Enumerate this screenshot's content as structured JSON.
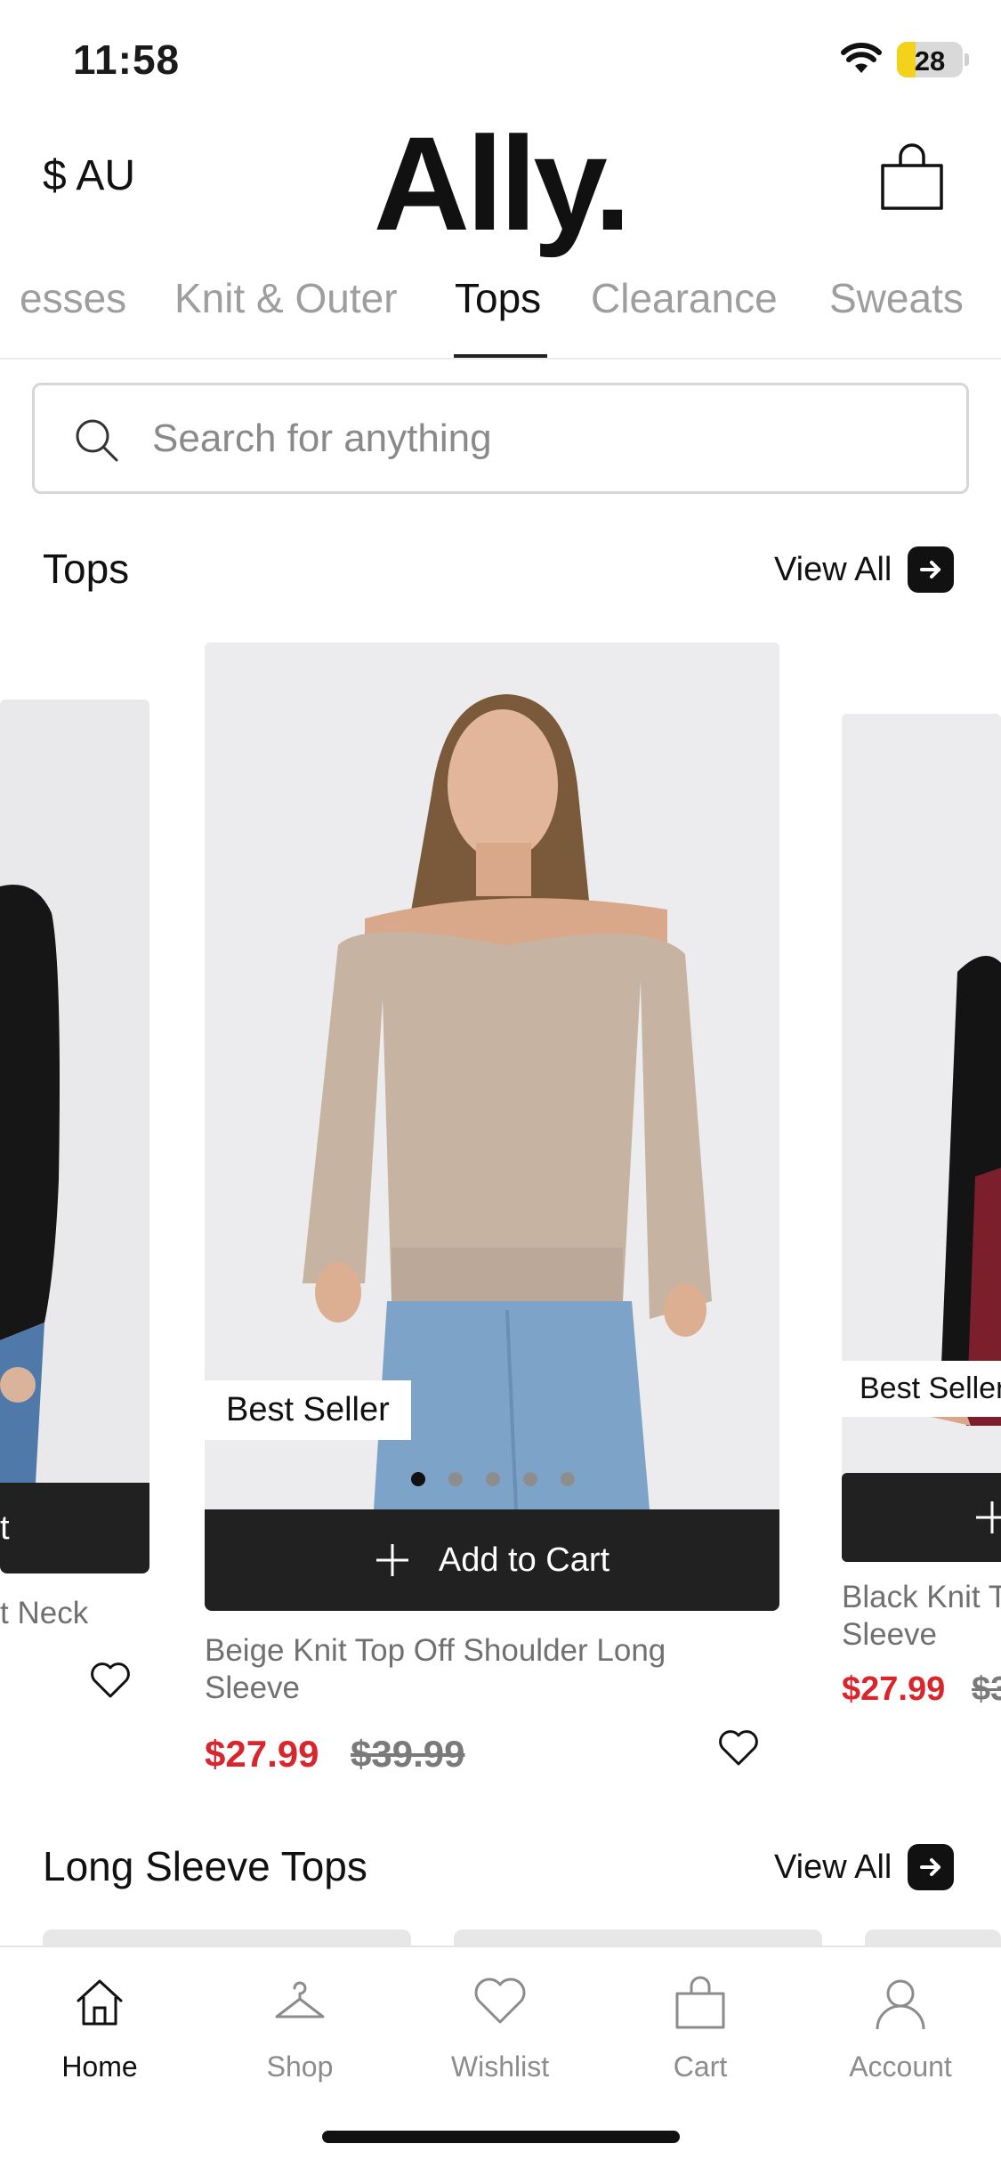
{
  "status_bar": {
    "time": "11:58",
    "battery": "28",
    "battery_fraction": 0.28
  },
  "header": {
    "currency": "$ AU",
    "logo": "Ally.",
    "bag_icon": "shopping-bag-icon"
  },
  "categories": {
    "items": [
      {
        "label": "esses"
      },
      {
        "label": "Knit & Outer"
      },
      {
        "label": "Tops"
      },
      {
        "label": "Clearance"
      },
      {
        "label": "Sweats"
      }
    ],
    "active": "Tops"
  },
  "search": {
    "placeholder": "Search for anything",
    "value": ""
  },
  "section_tops": {
    "title": "Tops",
    "view_all": "View All"
  },
  "products": [
    {
      "name": "t Neck",
      "cart_label": "t",
      "image_desc": "black long sleeve top"
    },
    {
      "badge": "Best Seller",
      "cart_label": "Add to Cart",
      "name": "Beige Knit Top Off Shoulder Long Sleeve",
      "price_sale": "$27.99",
      "price_original": "$39.99",
      "image_dots": 5,
      "active_dot": 0,
      "image_desc": "beige knit off shoulder top"
    },
    {
      "badge": "Best Seller",
      "name": "Black Knit To Sleeve",
      "name_line1": "Black Knit To",
      "name_line2": "Sleeve",
      "price_sale": "$27.99",
      "price_original": "$3",
      "image_desc": "black knit top with red skirt"
    }
  ],
  "section_long_sleeve": {
    "title": "Long Sleeve Tops",
    "view_all": "View All"
  },
  "tab_bar": {
    "items": [
      {
        "label": "Home",
        "icon": "home-icon"
      },
      {
        "label": "Shop",
        "icon": "hanger-icon"
      },
      {
        "label": "Wishlist",
        "icon": "heart-icon"
      },
      {
        "label": "Cart",
        "icon": "bag-icon"
      },
      {
        "label": "Account",
        "icon": "user-icon"
      }
    ],
    "active": "Home"
  },
  "colors": {
    "sale": "#d8262c",
    "dark": "#212121",
    "muted": "#9e9e9e",
    "battery": "#f4d21a"
  }
}
